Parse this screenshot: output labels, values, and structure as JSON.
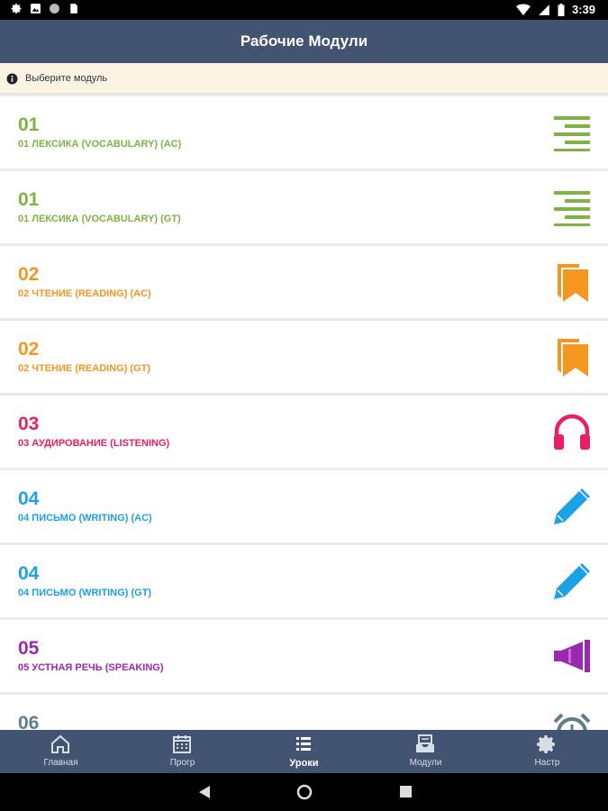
{
  "status_bar": {
    "time": "3:39"
  },
  "app_bar": {
    "title": "Рабочие Модули"
  },
  "banner": {
    "text": "Выберите модуль"
  },
  "modules": [
    {
      "number": "01",
      "title": "01 ЛЕКСИКА (VOCABULARY) (AC)",
      "color": "#7cb342",
      "icon": "text-lines-icon"
    },
    {
      "number": "01",
      "title": "01 ЛЕКСИКА (VOCABULARY) (GT)",
      "color": "#7cb342",
      "icon": "text-lines-icon"
    },
    {
      "number": "02",
      "title": "02 ЧТЕНИЕ (READING) (AC)",
      "color": "#f5961e",
      "icon": "bookmarks-icon"
    },
    {
      "number": "02",
      "title": "02 ЧТЕНИЕ (READING) (GT)",
      "color": "#f5961e",
      "icon": "bookmarks-icon"
    },
    {
      "number": "03",
      "title": "03 АУДИРОВАНИЕ (LISTENING)",
      "color": "#e91e63",
      "icon": "headphones-icon"
    },
    {
      "number": "04",
      "title": "04 ПИСЬМО (WRITING) (AC)",
      "color": "#1ca1e6",
      "icon": "pencil-icon"
    },
    {
      "number": "04",
      "title": "04 ПИСЬМО (WRITING) (GT)",
      "color": "#1ca1e6",
      "icon": "pencil-icon"
    },
    {
      "number": "05",
      "title": "05 УСТНАЯ РЕЧЬ (SPEAKING)",
      "color": "#9c27b0",
      "icon": "megaphone-icon"
    },
    {
      "number": "06",
      "title": "",
      "color": "#607d8b",
      "icon": "alarm-clock-icon"
    }
  ],
  "bottom_nav": {
    "home": "Главная",
    "progress": "Прогр",
    "lessons": "Уроки",
    "modules": "Модули",
    "settings": "Настр"
  }
}
